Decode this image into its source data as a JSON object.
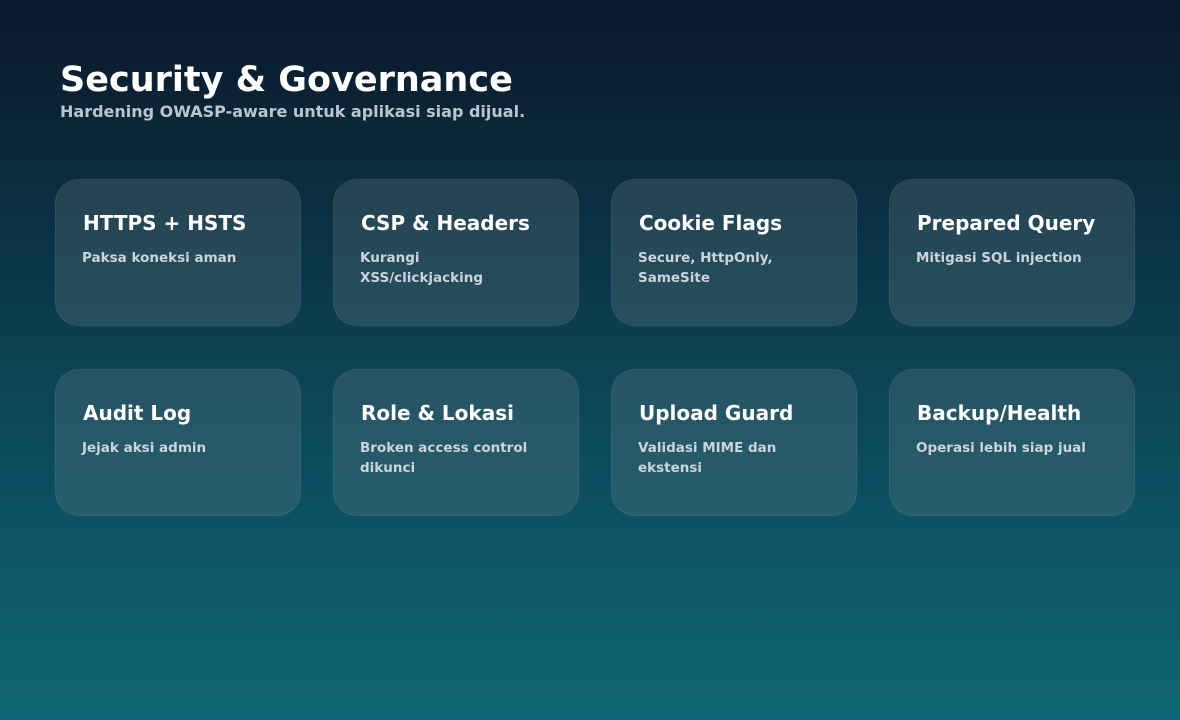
{
  "slide": {
    "title": "Security & Governance",
    "subtitle": "Hardening OWASP-aware untuk aplikasi siap dijual."
  },
  "cards": [
    {
      "title": "HTTPS + HSTS",
      "desc": "Paksa koneksi aman"
    },
    {
      "title": "CSP & Headers",
      "desc": "Kurangi XSS/clickjacking"
    },
    {
      "title": "Cookie Flags",
      "desc": "Secure, HttpOnly, SameSite"
    },
    {
      "title": "Prepared Query",
      "desc": "Mitigasi SQL injection"
    },
    {
      "title": "Audit Log",
      "desc": "Jejak aksi admin"
    },
    {
      "title": "Role & Lokasi",
      "desc": "Broken access control dikunci"
    },
    {
      "title": "Upload Guard",
      "desc": "Validasi MIME dan ekstensi"
    },
    {
      "title": "Backup/Health",
      "desc": "Operasi lebih siap jual"
    }
  ]
}
